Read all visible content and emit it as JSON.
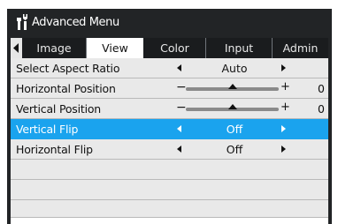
{
  "window": {
    "title": "Advanced Menu",
    "title_icon": "tools-icon"
  },
  "tabs": [
    {
      "label": "Image",
      "active": false
    },
    {
      "label": "View",
      "active": true
    },
    {
      "label": "Color",
      "active": false
    },
    {
      "label": "Input",
      "active": false
    },
    {
      "label": "Admin",
      "active": false
    }
  ],
  "rows": [
    {
      "label": "Select Aspect Ratio",
      "type": "choice",
      "value": "Auto",
      "selected": false
    },
    {
      "label": "Horizontal Position",
      "type": "slider",
      "value": "0",
      "level": 0.5,
      "selected": false
    },
    {
      "label": "Vertical Position",
      "type": "slider",
      "value": "0",
      "level": 0.5,
      "selected": false
    },
    {
      "label": "Vertical Flip",
      "type": "choice",
      "value": "Off",
      "selected": true
    },
    {
      "label": "Horizontal Flip",
      "type": "choice",
      "value": "Off",
      "selected": false
    }
  ],
  "empty_rows": 4,
  "colors": {
    "background": "#222426",
    "selected_row": "#1aa3ee",
    "row": "#e9e9e9",
    "active_tab": "#ffffff"
  }
}
